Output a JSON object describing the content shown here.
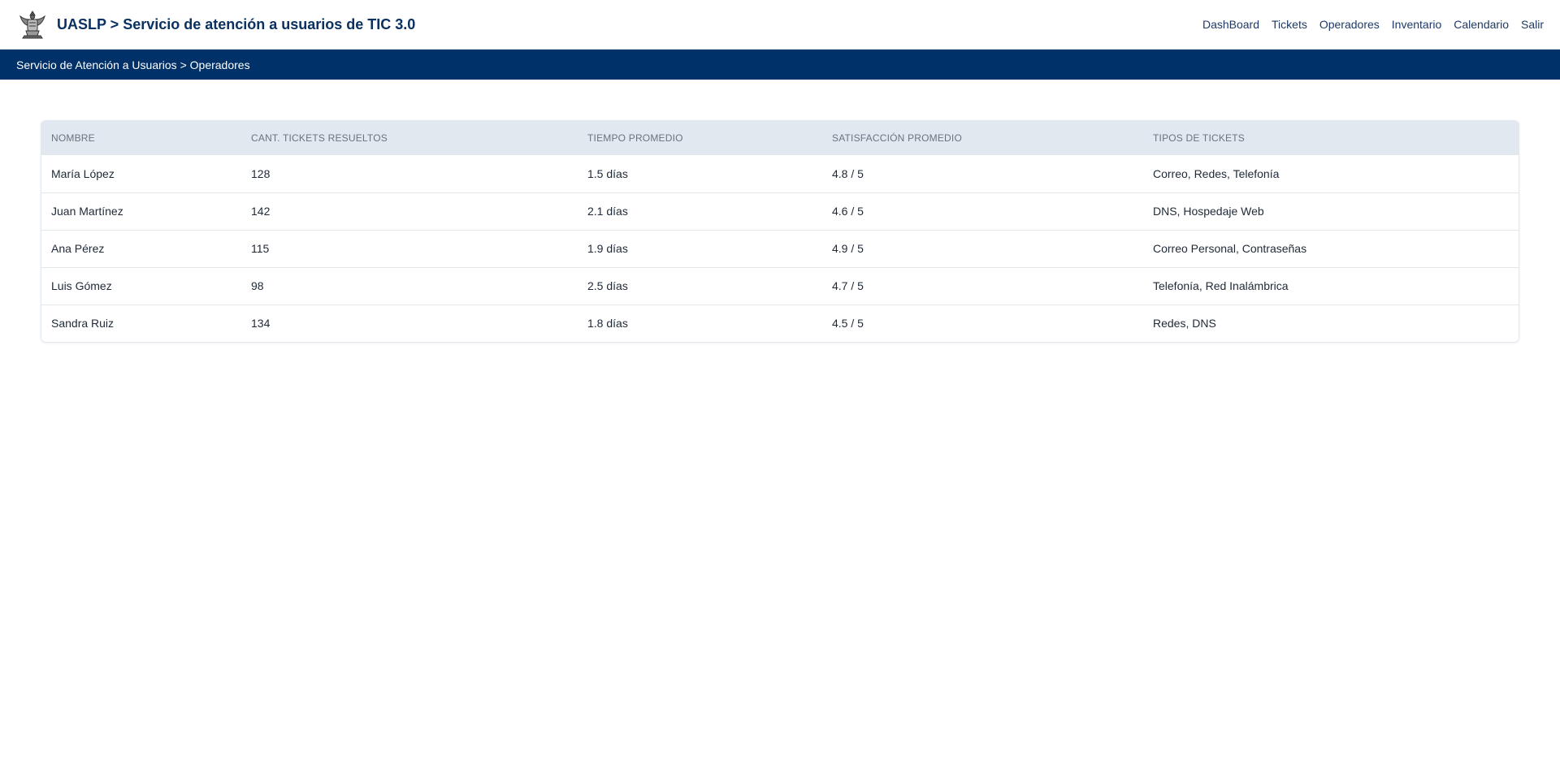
{
  "header": {
    "title": "UASLP > Servicio de atención a usuarios de TIC 3.0",
    "logo_icon": "uaslp-eagle-crest-icon",
    "nav": [
      {
        "label": "DashBoard"
      },
      {
        "label": "Tickets"
      },
      {
        "label": "Operadores"
      },
      {
        "label": "Inventario"
      },
      {
        "label": "Calendario"
      },
      {
        "label": "Salir"
      }
    ]
  },
  "breadcrumb": {
    "root": "Servicio de Atención a Usuarios",
    "separator": ">",
    "current": "Operadores"
  },
  "table": {
    "columns": [
      "NOMBRE",
      "CANT. TICKETS RESUELTOS",
      "TIEMPO PROMEDIO",
      "SATISFACCIÓN PROMEDIO",
      "TIPOS DE TICKETS"
    ],
    "rows": [
      {
        "nombre": "María López",
        "tickets": "128",
        "tiempo": "1.5 días",
        "satisfaccion": "4.8 / 5",
        "tipos": "Correo, Redes, Telefonía"
      },
      {
        "nombre": "Juan Martínez",
        "tickets": "142",
        "tiempo": "2.1 días",
        "satisfaccion": "4.6 / 5",
        "tipos": "DNS, Hospedaje Web"
      },
      {
        "nombre": "Ana Pérez",
        "tickets": "115",
        "tiempo": "1.9 días",
        "satisfaccion": "4.9 / 5",
        "tipos": "Correo Personal, Contraseñas"
      },
      {
        "nombre": "Luis Gómez",
        "tickets": "98",
        "tiempo": "2.5 días",
        "satisfaccion": "4.7 / 5",
        "tipos": "Telefonía, Red Inalámbrica"
      },
      {
        "nombre": "Sandra Ruiz",
        "tickets": "134",
        "tiempo": "1.8 días",
        "satisfaccion": "4.5 / 5",
        "tipos": "Redes, DNS"
      }
    ]
  },
  "colors": {
    "brand_navy": "#003168",
    "title_navy": "#0a3161",
    "table_header_bg": "#e2e8f0"
  }
}
